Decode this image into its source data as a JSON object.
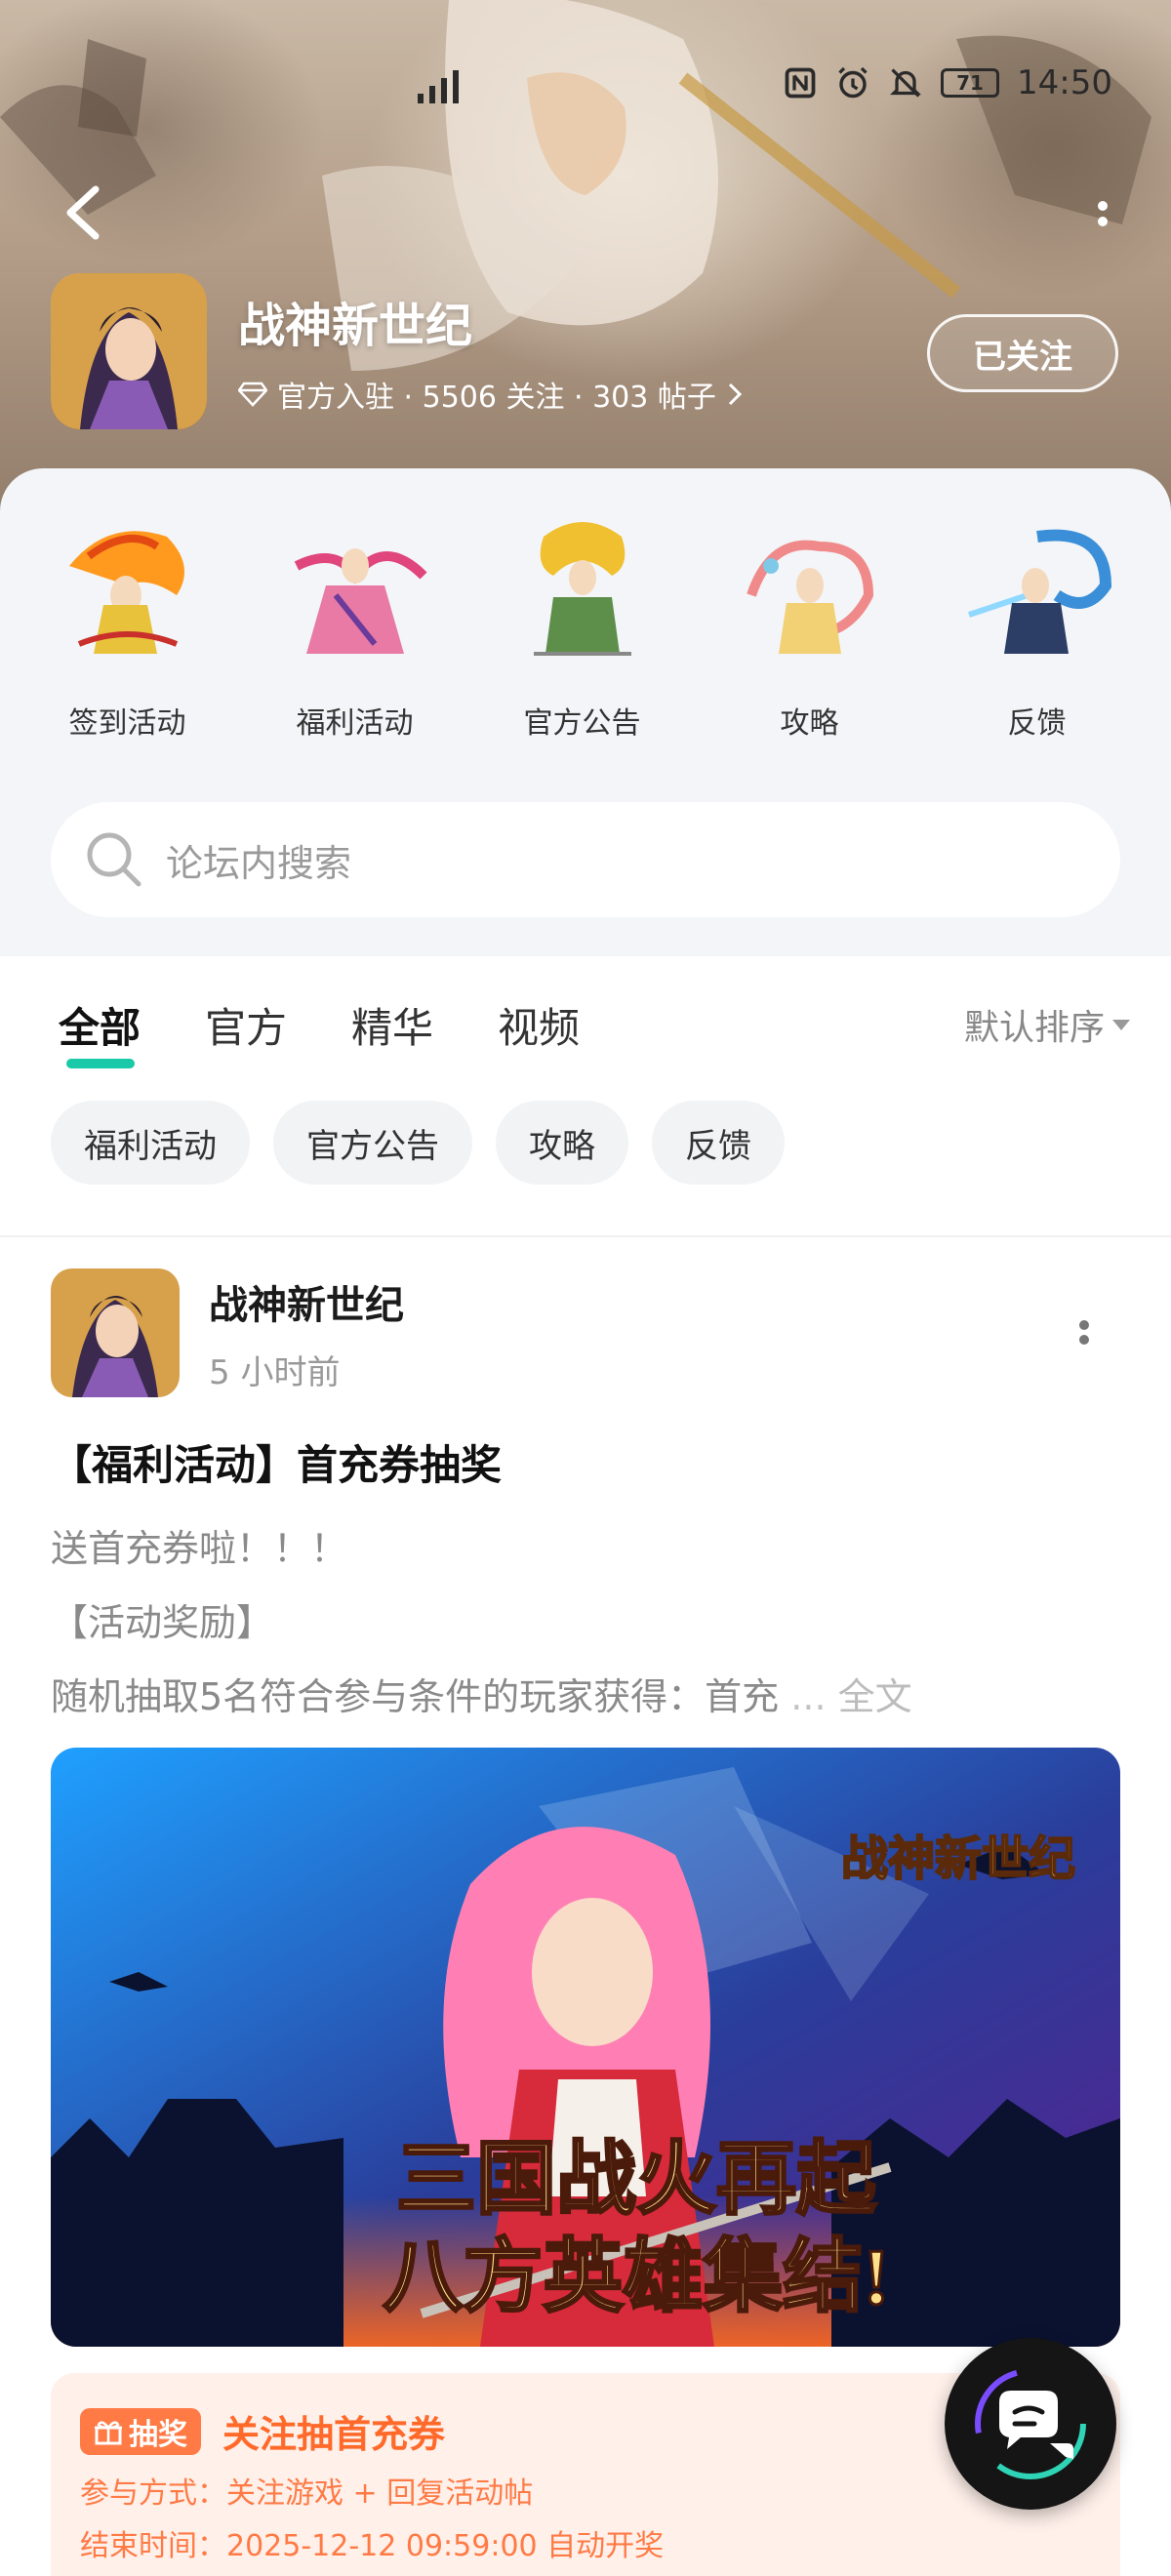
{
  "status_bar": {
    "network": "4G",
    "battery": "71",
    "time": "14:50"
  },
  "forum": {
    "name": "战神新世纪",
    "meta": "官方入驻 · 5506 关注 · 303 帖子",
    "follow_label": "已关注"
  },
  "shortcuts": [
    {
      "label": "签到活动"
    },
    {
      "label": "福利活动"
    },
    {
      "label": "官方公告"
    },
    {
      "label": "攻略"
    },
    {
      "label": "反馈"
    }
  ],
  "search": {
    "placeholder": "论坛内搜索"
  },
  "tabs": [
    {
      "label": "全部",
      "active": true
    },
    {
      "label": "官方",
      "active": false
    },
    {
      "label": "精华",
      "active": false
    },
    {
      "label": "视频",
      "active": false
    }
  ],
  "sort": {
    "label": "默认排序"
  },
  "chips": [
    {
      "label": "福利活动"
    },
    {
      "label": "官方公告"
    },
    {
      "label": "攻略"
    },
    {
      "label": "反馈"
    }
  ],
  "post": {
    "author": "战神新世纪",
    "time": "5 小时前",
    "title": "【福利活动】首充券抽奖",
    "lines": [
      "送首充券啦！！！",
      "【活动奖励】",
      "随机抽取5名符合参与条件的玩家获得：首充"
    ],
    "ellipsis": "...",
    "full_text_label": "全文",
    "banner": {
      "logo_text": "战神新世纪",
      "slogan_line1": "三国战火再起",
      "slogan_line2": "八方英雄集结!"
    }
  },
  "lottery": {
    "badge": "抽奖",
    "title": "关注抽首充券",
    "method": "参与方式：关注游戏 + 回复活动帖",
    "end_time": "结束时间：2025-12-12 09:59:00 自动开奖"
  },
  "colors": {
    "accent": "#19c9a8",
    "lottery": "#ff6a2b"
  }
}
